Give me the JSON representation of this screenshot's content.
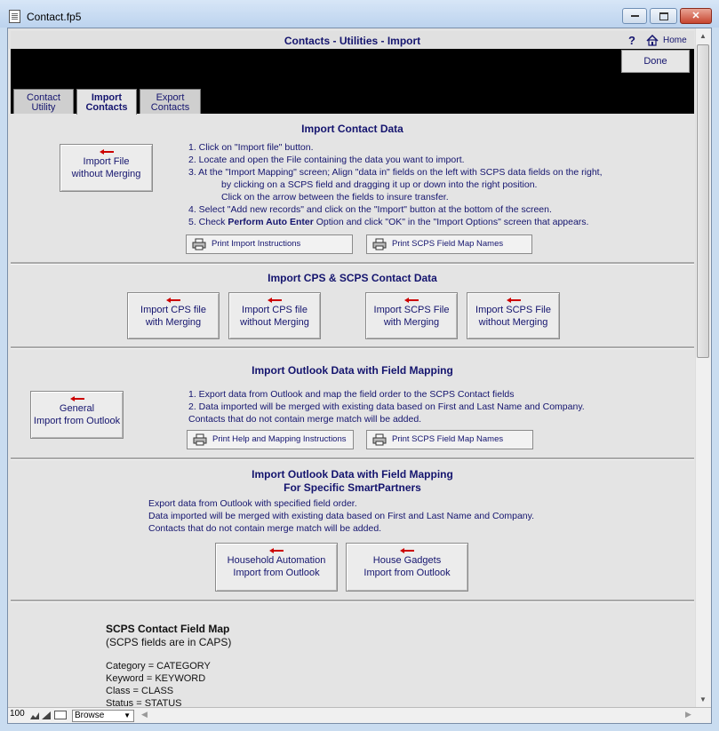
{
  "window": {
    "title": "Contact.fp5",
    "buttons": {
      "minimize": "▭",
      "maximize": "□",
      "close": "✕"
    }
  },
  "header": {
    "title": "Contacts - Utilities - Import",
    "help_label": "?",
    "home_label": "Home",
    "done_label": "Done"
  },
  "tabs": [
    {
      "line1": "Contact",
      "line2": "Utility",
      "active": false
    },
    {
      "line1": "Import",
      "line2": "Contacts",
      "active": true
    },
    {
      "line1": "Export",
      "line2": "Contacts",
      "active": false
    }
  ],
  "import_contact": {
    "title": "Import Contact Data",
    "button": {
      "line1": "Import  File",
      "line2": "without Merging"
    },
    "steps": [
      "1.  Click on \"Import  file\" button.",
      "2.  Locate and open the File containing the data you want to import.",
      "3.  At the \"Import Mapping\" screen;   Align \"data in\" fields on the left with SCPS data fields on the right,",
      "by clicking on a SCPS field and dragging it up or down into the right position.",
      "Click on the arrow between the fields to insure transfer.",
      "4.  Select \"Add new records\" and click on the \"Import\" button at the bottom of the screen."
    ],
    "step5_prefix": "5.  Check ",
    "step5_bold": "Perform Auto Enter",
    "step5_suffix": " Option and click  \"OK\" in the \"Import Options\" screen that appears.",
    "print_instructions": "Print Import Instructions",
    "print_field_map": "Print SCPS Field Map Names"
  },
  "import_cps": {
    "title": "Import CPS & SCPS Contact Data",
    "buttons": [
      {
        "line1": "Import CPS file",
        "line2": "with Merging"
      },
      {
        "line1": "Import CPS file",
        "line2": "without Merging"
      },
      {
        "line1": "Import SCPS File",
        "line2": "with Merging"
      },
      {
        "line1": "Import SCPS File",
        "line2": "without Merging"
      }
    ]
  },
  "import_outlook": {
    "title": "Import Outlook Data with Field Mapping",
    "button": {
      "line1": "General",
      "line2": "Import from Outlook"
    },
    "lines": [
      "1. Export data from Outlook and map the field order to the SCPS Contact fields",
      "2. Data imported will be merged with existing data based on First and Last Name and Company.",
      "Contacts that do not contain merge match will be added."
    ],
    "print_help": "Print Help and Mapping Instructions",
    "print_field_map": "Print SCPS Field Map Names"
  },
  "import_smartpartners": {
    "title_line1": "Import Outlook Data with Field Mapping",
    "title_line2": "For Specific SmartPartners",
    "lines": [
      "Export data from Outlook with specified field order.",
      "Data imported will be merged with existing data based on First and Last Name and Company.",
      "Contacts that do not contain merge match will be added."
    ],
    "buttons": [
      {
        "line1": "Household Automation",
        "line2": "Import from Outlook"
      },
      {
        "line1": "House Gadgets",
        "line2": "Import from Outlook"
      }
    ]
  },
  "field_map": {
    "title": "SCPS Contact Field Map",
    "subtitle": "(SCPS fields are in CAPS)",
    "rows": [
      "Category = CATEGORY",
      "Keyword = KEYWORD",
      "Class = CLASS",
      "Status = STATUS"
    ]
  },
  "statusbar": {
    "zoom": "100",
    "mode": "Browse"
  },
  "colors": {
    "text": "#14146e",
    "panel": "#e4e4e4",
    "arrow": "#cc0000"
  }
}
